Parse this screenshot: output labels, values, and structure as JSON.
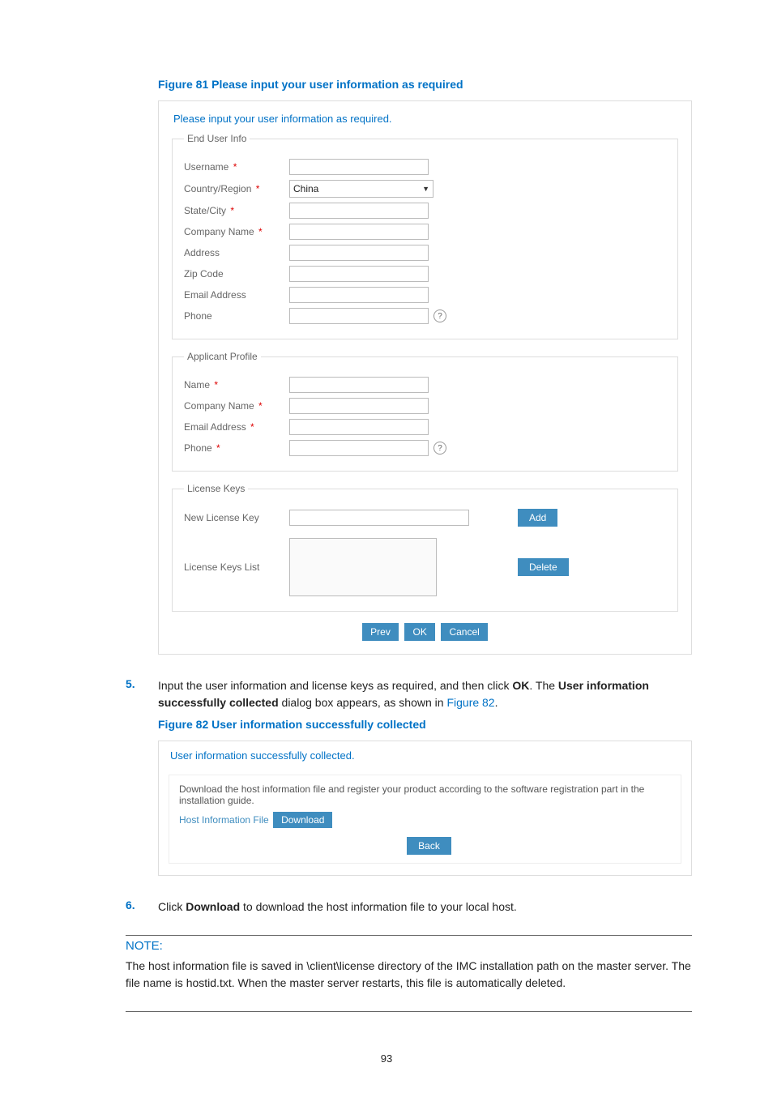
{
  "figure81_title": "Figure 81 Please input your user information as required",
  "panel1_header": "Please input your user information as required.",
  "end_user_info": {
    "legend": "End User Info",
    "username_label": "Username",
    "country_label": "Country/Region",
    "country_value": "China",
    "state_label": "State/City",
    "company_label": "Company Name",
    "address_label": "Address",
    "zip_label": "Zip Code",
    "email_label": "Email Address",
    "phone_label": "Phone"
  },
  "applicant_profile": {
    "legend": "Applicant Profile",
    "name_label": "Name",
    "company_label": "Company Name",
    "email_label": "Email Address",
    "phone_label": "Phone"
  },
  "license_keys": {
    "legend": "License Keys",
    "new_label": "New License Key",
    "list_label": "License Keys List",
    "add_btn": "Add",
    "delete_btn": "Delete"
  },
  "panel1_buttons": {
    "prev": "Prev",
    "ok": "OK",
    "cancel": "Cancel"
  },
  "step5": {
    "num": "5.",
    "text_a": "Input the user information and license keys as required, and then click ",
    "ok": "OK",
    "text_b": ". The ",
    "bold1": "User information successfully collected",
    "text_c": " dialog box appears, as shown in ",
    "fig_ref": "Figure 82",
    "text_d": "."
  },
  "figure82_title": "Figure 82 User information successfully collected",
  "panel2_header": "User information successfully collected.",
  "panel2_body_text": "Download the host information file and register your product according to the software registration part in the installation guide.",
  "hostinfo_label": "Host Information File",
  "download_btn": "Download",
  "back_btn": "Back",
  "step6": {
    "num": "6.",
    "text_a": "Click ",
    "bold": "Download",
    "text_b": " to download the host information file to your local host."
  },
  "note_title": "NOTE:",
  "note_a": "The host information file is saved in ",
  "note_path": "\\client\\license",
  "note_b": " directory of the IMC installation path on the master server. The file name is ",
  "note_file": "hostid.txt",
  "note_c": ". When the master server restarts, this file is automatically deleted.",
  "page_num": "93",
  "help_glyph": "?"
}
